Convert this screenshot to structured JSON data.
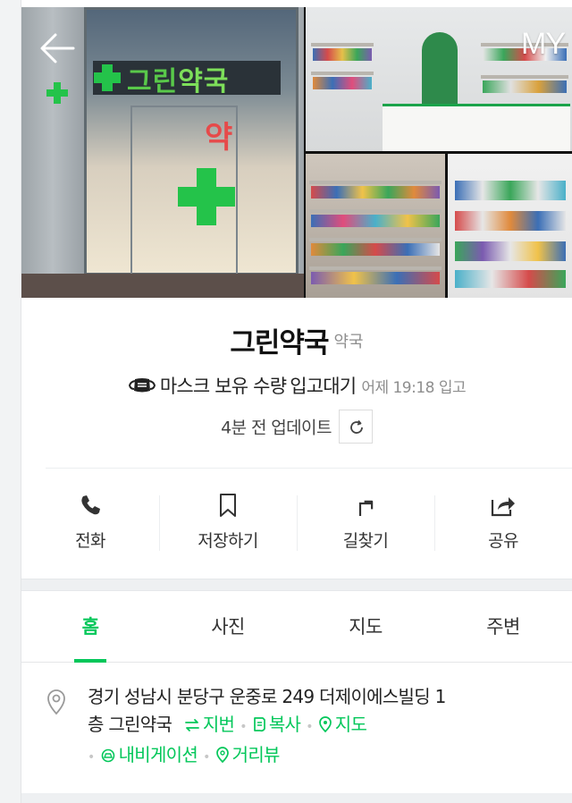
{
  "header": {
    "my_label": "MY"
  },
  "place": {
    "name": "그린약국",
    "category": "약국",
    "sign_name": "그린",
    "sign_highlight": "약국",
    "sign_red_char": "약"
  },
  "mask": {
    "text": "마스크 보유 수량",
    "status": "입고대기",
    "time": "어제 19:18 입고",
    "updated": "4분 전 업데이트"
  },
  "actions": [
    {
      "label": "전화",
      "icon": "phone-icon"
    },
    {
      "label": "저장하기",
      "icon": "bookmark-icon"
    },
    {
      "label": "길찾기",
      "icon": "directions-icon"
    },
    {
      "label": "공유",
      "icon": "share-icon"
    }
  ],
  "tabs": [
    {
      "label": "홈",
      "active": true
    },
    {
      "label": "사진",
      "active": false
    },
    {
      "label": "지도",
      "active": false
    },
    {
      "label": "주변",
      "active": false
    }
  ],
  "address": {
    "line1": "경기 성남시 분당구 운중로 249 더제이에스빌딩 1",
    "line2": "층 그린약국",
    "links": {
      "jibun": "지번",
      "copy": "복사",
      "map": "지도",
      "navigation": "내비게이션",
      "street_view": "거리뷰"
    }
  },
  "colors": {
    "accent": "#03c75a",
    "muted": "#8e8e8e"
  }
}
